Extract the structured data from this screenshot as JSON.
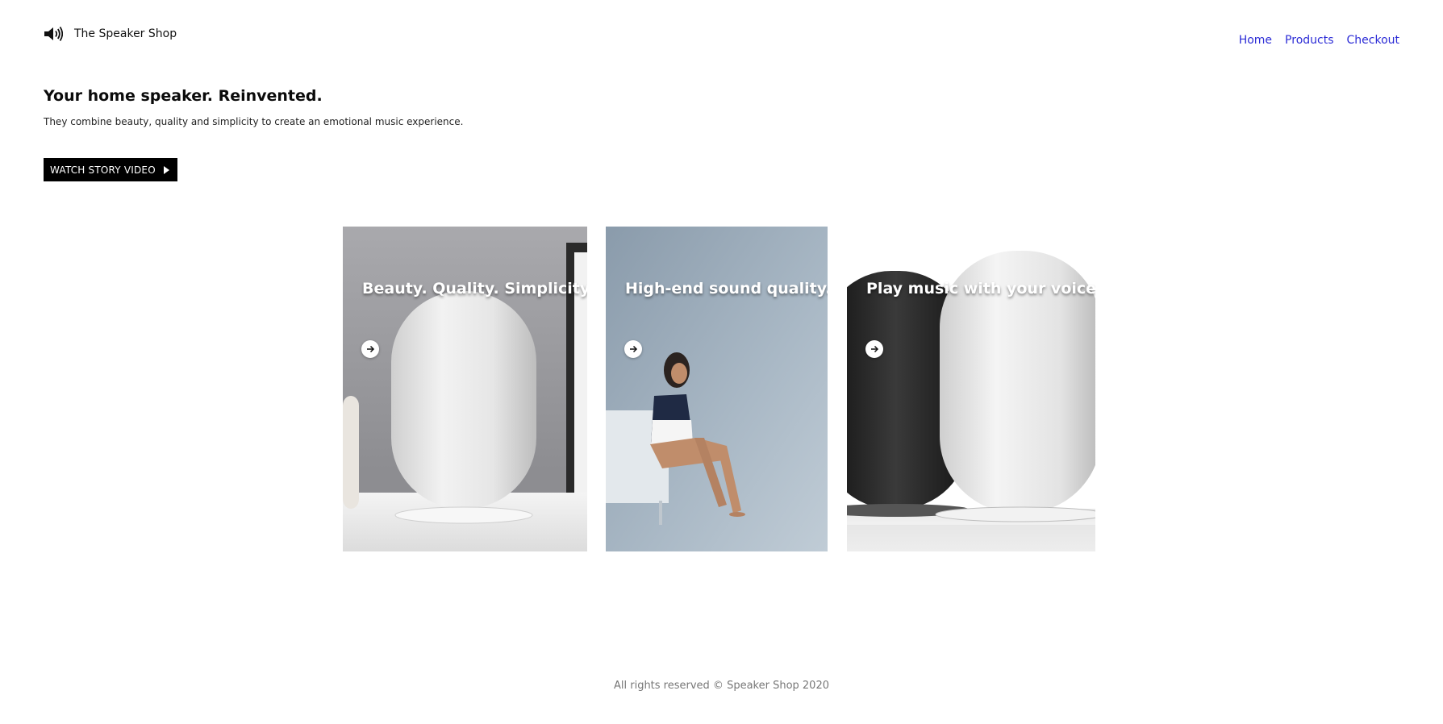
{
  "header": {
    "brand_icon": "speaker-icon",
    "brand_name": "The Speaker Shop",
    "nav": [
      {
        "label": "Home"
      },
      {
        "label": "Products"
      },
      {
        "label": "Checkout"
      }
    ]
  },
  "hero": {
    "title": "Your home speaker. Reinvented.",
    "subtitle": "They combine beauty, quality and simplicity to create an emotional music experience.",
    "cta_label": "WATCH STORY VIDEO",
    "cta_icon": "play-icon"
  },
  "cards": [
    {
      "title": "Beauty. Quality. Simplicity.",
      "icon": "arrow-right-icon"
    },
    {
      "title": "High-end sound quality.",
      "icon": "arrow-right-icon"
    },
    {
      "title": "Play music with your voice.",
      "icon": "arrow-right-icon"
    }
  ],
  "footer": {
    "text": "All rights reserved © Speaker Shop 2020"
  },
  "colors": {
    "nav_link": "#2b2bd6",
    "cta_bg": "#000000",
    "footer_text": "#777777"
  }
}
